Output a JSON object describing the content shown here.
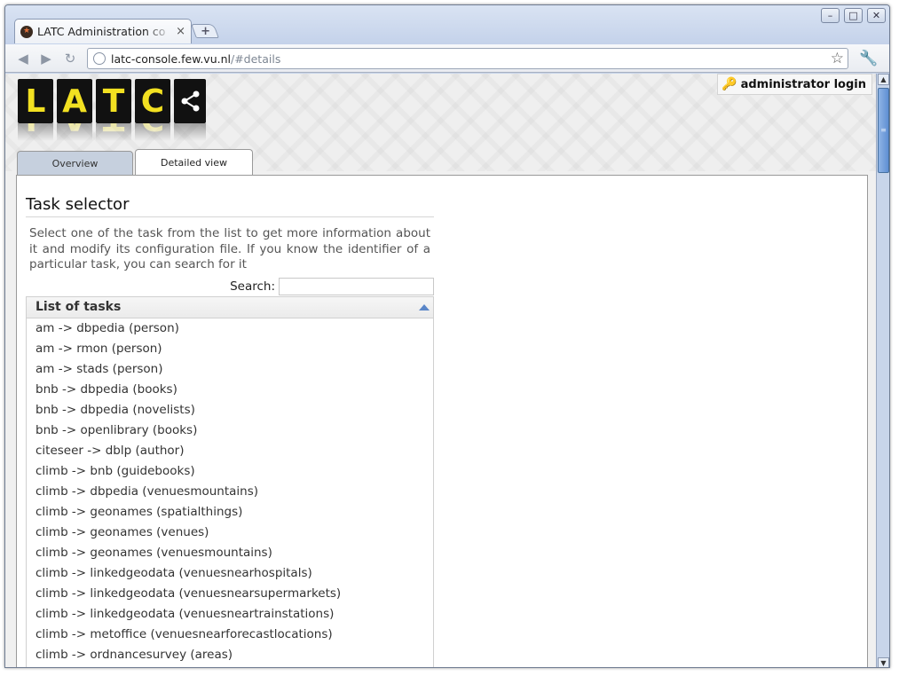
{
  "browser": {
    "tab_title": "LATC Administration co",
    "tab_close": "×",
    "new_tab": "+",
    "url_host": "latc-console.few.vu.nl",
    "url_rest": "/#details",
    "window_controls": {
      "minimize": "–",
      "maximize": "□",
      "close": "✕"
    }
  },
  "site": {
    "logo_letters": [
      "L",
      "A",
      "T",
      "C"
    ],
    "admin_login": "administrator login",
    "colors": {
      "logo_yellow": "#f2e021",
      "logo_black": "#111111",
      "accent_blue": "#5a86c8"
    }
  },
  "tabs": [
    {
      "label": "Overview",
      "active": false
    },
    {
      "label": "Detailed view",
      "active": true
    }
  ],
  "task_selector": {
    "title": "Task selector",
    "description": "Select one of the task from the list to get more information about it and modify its configuration file. If you know the identifier of a particular task, you can search for it",
    "search_label": "Search:",
    "search_value": "",
    "list_header": "List of tasks",
    "tasks": [
      "am -> dbpedia (person)",
      "am -> rmon (person)",
      "am -> stads (person)",
      "bnb -> dbpedia (books)",
      "bnb -> dbpedia (novelists)",
      "bnb -> openlibrary (books)",
      "citeseer -> dblp (author)",
      "climb -> bnb (guidebooks)",
      "climb -> dbpedia (venuesmountains)",
      "climb -> geonames (spatialthings)",
      "climb -> geonames (venues)",
      "climb -> geonames (venuesmountains)",
      "climb -> linkedgeodata (venuesnearhospitals)",
      "climb -> linkedgeodata (venuesnearsupermarkets)",
      "climb -> linkedgeodata (venuesneartrainstations)",
      "climb -> metoffice (venuesnearforecastlocations)",
      "climb -> ordnancesurvey (areas)"
    ]
  }
}
